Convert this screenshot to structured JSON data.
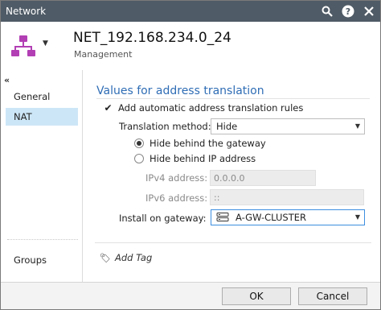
{
  "window": {
    "title": "Network",
    "colors": {
      "titlebar": "#4f5b66",
      "accent": "#2f6db5",
      "object_icon": "#b23fb4",
      "nav_active": "#cde6f7"
    }
  },
  "header": {
    "object_name": "NET_192.168.234.0_24",
    "object_type": "Management",
    "icon": "network-object-icon"
  },
  "sidebar": {
    "collapse_glyph": "«",
    "items": [
      {
        "label": "General",
        "active": false
      },
      {
        "label": "NAT",
        "active": true
      },
      {
        "label": "Groups",
        "active": false
      }
    ]
  },
  "nat": {
    "section_title": "Values for address translation",
    "auto_rules_label": "Add automatic address translation rules",
    "auto_rules_checked": true,
    "method_label": "Translation method:",
    "method_value": "Hide",
    "hide_gateway_label": "Hide behind the gateway",
    "hide_ip_label": "Hide behind IP address",
    "selected_option": "hide_gateway",
    "ipv4_label": "IPv4 address:",
    "ipv4_value": "0.0.0.0",
    "ipv6_label": "IPv6 address:",
    "ipv6_value": "::",
    "install_label": "Install on gateway:",
    "install_value": "A-GW-CLUSTER"
  },
  "add_tag": "Add Tag",
  "buttons": {
    "ok": "OK",
    "cancel": "Cancel"
  }
}
